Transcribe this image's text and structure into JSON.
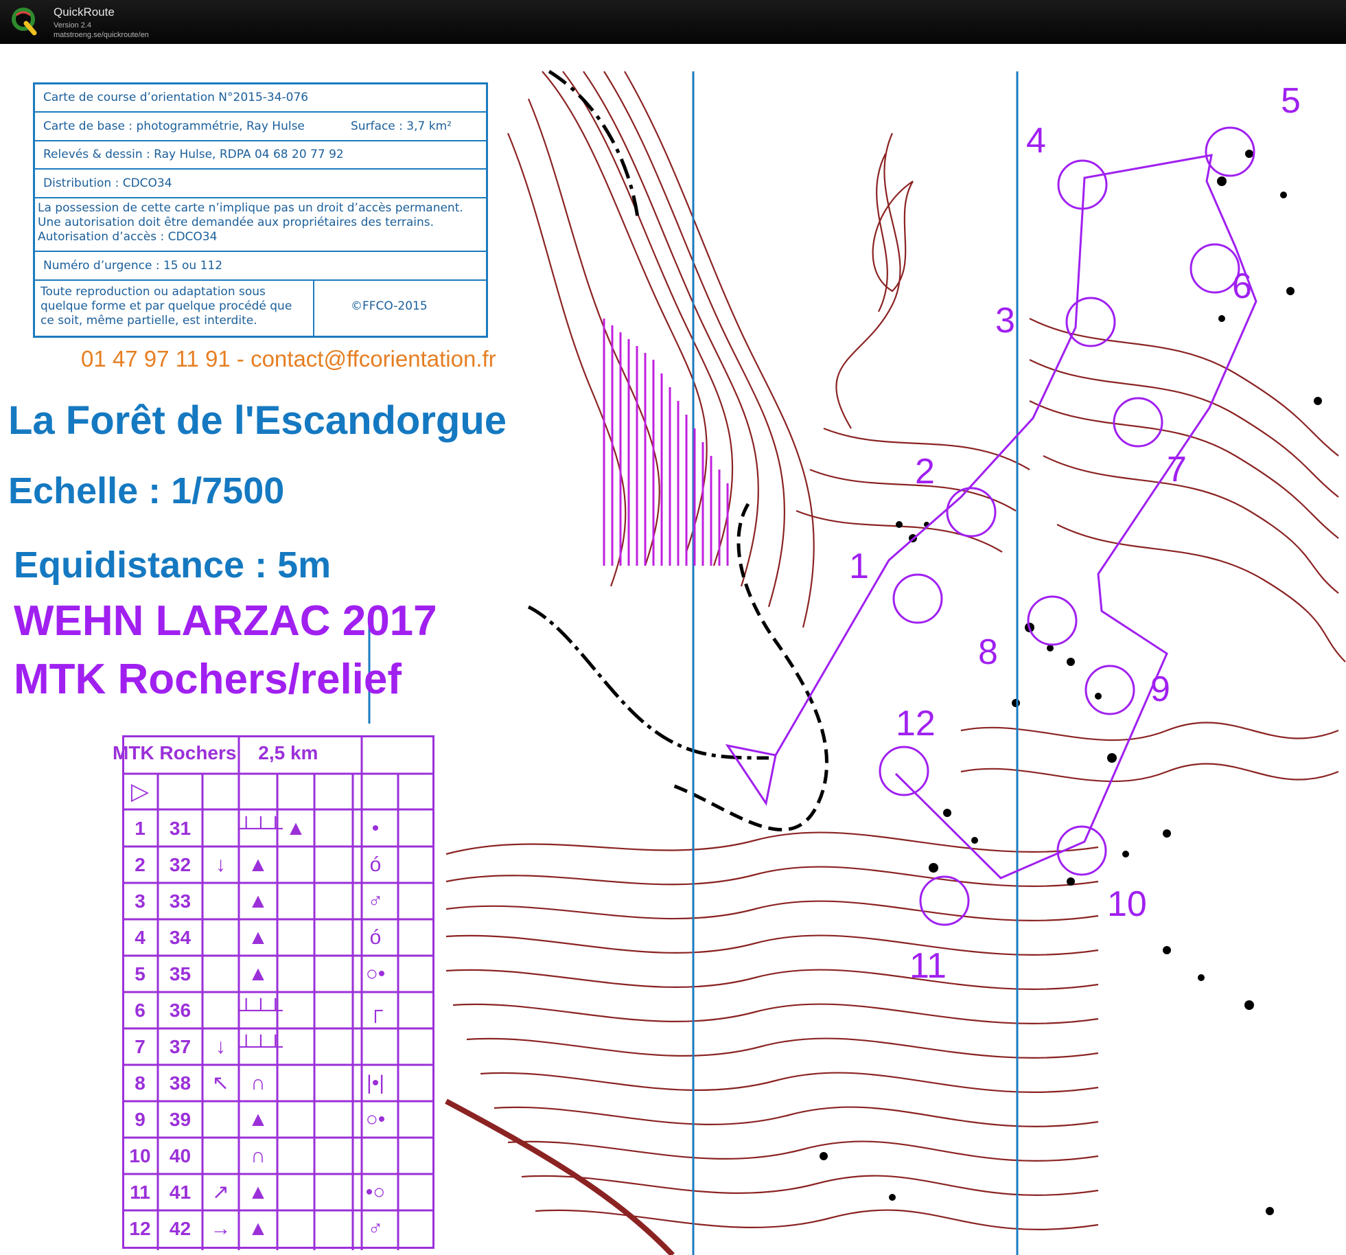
{
  "app": {
    "name": "QuickRoute",
    "version": "Version 2.4",
    "url": "matstroeng.se/quickroute/en"
  },
  "cartouche": {
    "rows": [
      {
        "text": "Carte de course d’orientation N°2015-34-076"
      },
      {
        "text": "Carte de base : photogrammétrie, Ray Hulse",
        "extra": "Surface : 3,7 km²"
      },
      {
        "text": "Relevés & dessin : Ray Hulse, RDPA 04 68 20 77 92"
      },
      {
        "text": "Distribution : CDCO34"
      },
      {
        "line1": "La possession de cette carte n’implique pas un droit d’accès permanent.",
        "line2": "Une autorisation doit être demandée aux propriétaires des terrains.",
        "line3": "Autorisation d’accès : CDCO34"
      },
      {
        "text": "Numéro d’urgence : 15 ou 112"
      },
      {
        "line1": "Toute reproduction ou adaptation sous",
        "line2": "quelque forme et par quelque procédé que",
        "line3": "ce soit, même partielle, est interdite.",
        "copyright": "©FFCO-2015"
      }
    ]
  },
  "contact": "01 47 97 11 91 - contact@ffcorientation.fr",
  "map_title": "La Forêt de l'Escandorgue",
  "scale": "Echelle : 1/7500",
  "contour_interval": "Equidistance : 5m",
  "event": "WEHN LARZAC 2017",
  "course_name": "MTK Rochers/relief",
  "control_table": {
    "title": "MTK Rochers",
    "distance": "2,5 km",
    "start_symbol": "▷",
    "rows": [
      {
        "num": "1",
        "code": "31",
        "dir": "",
        "feature": "┴┴┴",
        "detail": "▲",
        "pos": "•"
      },
      {
        "num": "2",
        "code": "32",
        "dir": "↓",
        "feature": "▲",
        "detail": "",
        "pos": "ó"
      },
      {
        "num": "3",
        "code": "33",
        "dir": "",
        "feature": "▲",
        "detail": "",
        "pos": "♂"
      },
      {
        "num": "4",
        "code": "34",
        "dir": "",
        "feature": "▲",
        "detail": "",
        "pos": "ó"
      },
      {
        "num": "5",
        "code": "35",
        "dir": "",
        "feature": "▲",
        "detail": "",
        "pos": "○•"
      },
      {
        "num": "6",
        "code": "36",
        "dir": "",
        "feature": "┴┴┴",
        "detail": "",
        "pos": "┌"
      },
      {
        "num": "7",
        "code": "37",
        "dir": "↓",
        "feature": "┴┴┴",
        "detail": "",
        "pos": ""
      },
      {
        "num": "8",
        "code": "38",
        "dir": "↖",
        "feature": "∩",
        "detail": "",
        "pos": "|•|"
      },
      {
        "num": "9",
        "code": "39",
        "dir": "",
        "feature": "▲",
        "detail": "",
        "pos": "○•"
      },
      {
        "num": "10",
        "code": "40",
        "dir": "",
        "feature": "∩",
        "detail": "",
        "pos": ""
      },
      {
        "num": "11",
        "code": "41",
        "dir": "↗",
        "feature": "▲",
        "detail": "",
        "pos": "•○"
      },
      {
        "num": "12",
        "code": "42",
        "dir": "→",
        "feature": "▲",
        "detail": "",
        "pos": "♂"
      }
    ]
  },
  "course": {
    "control_labels": [
      "1",
      "2",
      "3",
      "4",
      "5",
      "6",
      "7",
      "8",
      "9",
      "10",
      "11",
      "12"
    ]
  },
  "colors": {
    "contour": "#8b2323",
    "course": "#a020f0",
    "water": "#1b7bbf",
    "titlebar": "#0a0a0a"
  }
}
